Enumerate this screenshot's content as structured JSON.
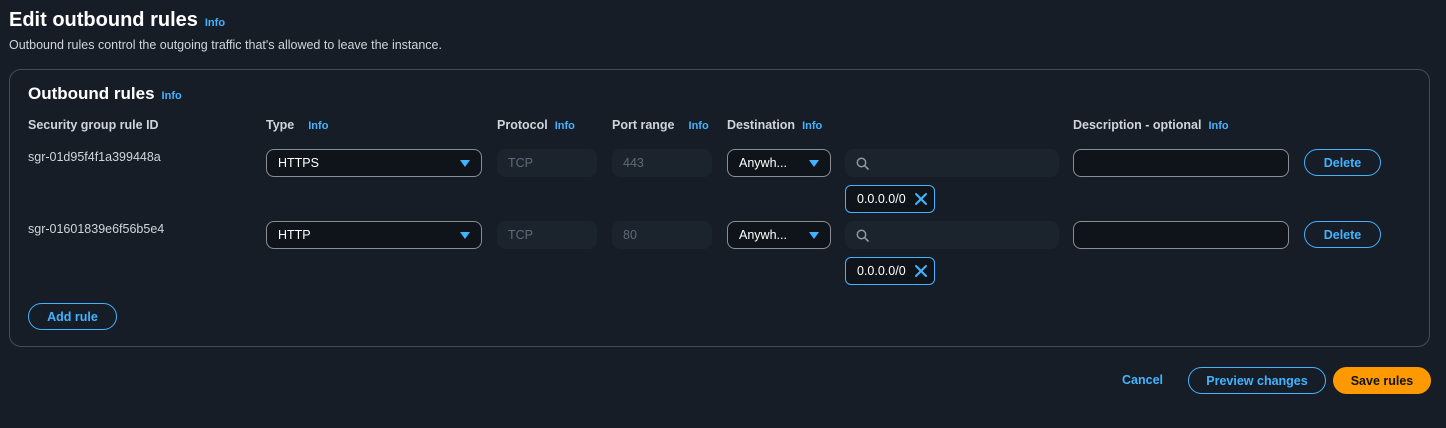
{
  "page": {
    "title": "Edit outbound rules",
    "info": "Info",
    "subtitle": "Outbound rules control the outgoing traffic that's allowed to leave the instance."
  },
  "panel": {
    "title": "Outbound rules",
    "info": "Info"
  },
  "columns": {
    "rule_id": "Security group rule ID",
    "type": "Type",
    "protocol": "Protocol",
    "port_range": "Port range",
    "destination": "Destination",
    "description": "Description - optional",
    "info": "Info"
  },
  "rules": [
    {
      "id": "sgr-01d95f4f1a399448a",
      "type": "HTTPS",
      "protocol": "TCP",
      "port_range": "443",
      "destination": "Anywh...",
      "cidr": "0.0.0.0/0",
      "description": "",
      "delete_label": "Delete"
    },
    {
      "id": "sgr-01601839e6f56b5e4",
      "type": "HTTP",
      "protocol": "TCP",
      "port_range": "80",
      "destination": "Anywh...",
      "cidr": "0.0.0.0/0",
      "description": "",
      "delete_label": "Delete"
    }
  ],
  "actions": {
    "add_rule": "Add rule",
    "cancel": "Cancel",
    "preview": "Preview changes",
    "save": "Save rules"
  },
  "colors": {
    "background": "#161d26",
    "accent": "#42b4ff",
    "primary": "#ff9900",
    "border": "#414d5c"
  },
  "icons": {
    "dropdown": "caret-down-icon",
    "search": "search-icon",
    "remove": "close-icon"
  }
}
